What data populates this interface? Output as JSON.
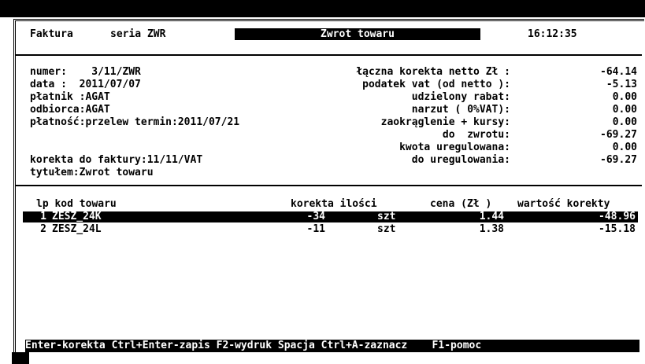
{
  "header": {
    "doc_type": "Faktura",
    "series": "seria ZWR",
    "mode": "Zwrot towaru",
    "time": "16:12:35"
  },
  "info": {
    "numer": "numer:    3/11/ZWR",
    "data": "data :  2011/07/07",
    "platnik": "płatnik :AGAT",
    "odbiorca": "odbiorca:AGAT",
    "platnosc": "płatność:przelew termin:2011/07/21",
    "korekta_do": "korekta do faktury:11/11/VAT",
    "tytulem": "tytułem:Zwrot towaru"
  },
  "summary": [
    {
      "label": "łączna korekta netto Zł :",
      "value": "-64.14"
    },
    {
      "label": "podatek vat (od netto ):",
      "value": "-5.13"
    },
    {
      "label": "udzielony rabat:",
      "value": "0.00"
    },
    {
      "label": "narzut ( 0%VAT):",
      "value": "0.00"
    },
    {
      "label": "zaokrąglenie + kursy:",
      "value": "0.00"
    },
    {
      "label": "do  zwrotu:",
      "value": "-69.27"
    },
    {
      "label": "kwota uregulowana:",
      "value": "0.00"
    },
    {
      "label": "do uregulowania:",
      "value": "-69.27"
    }
  ],
  "table": {
    "columns": [
      "lp kod towaru",
      "korekta ilości",
      "cena (Zł )",
      "wartość korekty"
    ],
    "rows": [
      {
        "lp": "1",
        "kod": "ZESZ_24K",
        "korekta": "-34",
        "jm": "szt",
        "cena": "1.44",
        "wartosc": "-48.96"
      },
      {
        "lp": "2",
        "kod": "ZESZ_24L",
        "korekta": "-11",
        "jm": "szt",
        "cena": "1.38",
        "wartosc": "-15.18"
      }
    ]
  },
  "statusbar": {
    "text": "Enter-korekta Ctrl+Enter-zapis F2-wydruk Spacja Ctrl+A-zaznacz    F1-pomoc"
  }
}
